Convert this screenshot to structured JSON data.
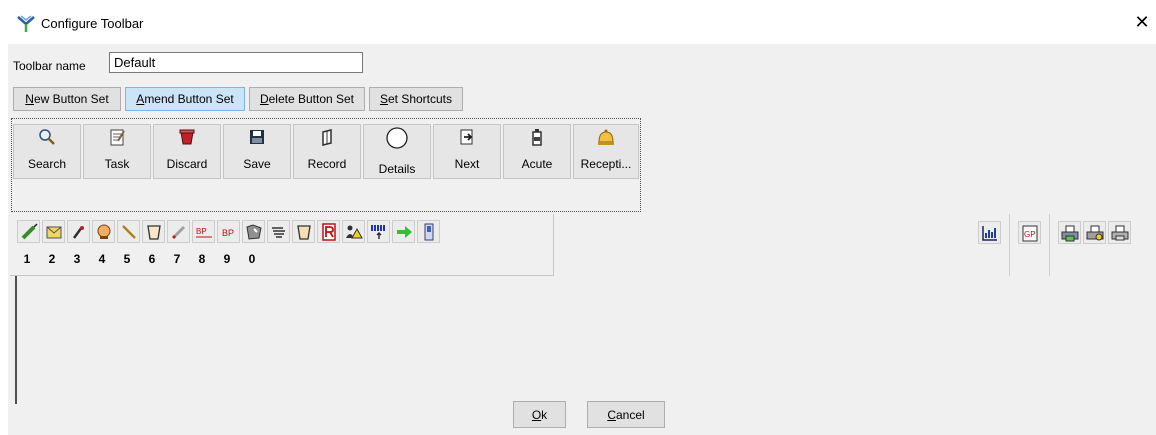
{
  "window": {
    "title": "Configure Toolbar",
    "app_icon": "dock-arrow-icon",
    "close_icon": "close-icon",
    "close_glyph": "✕"
  },
  "toolbar_name": {
    "label": "Toolbar name",
    "value": "Default"
  },
  "set_buttons": [
    {
      "label": "New Button Set",
      "active": false
    },
    {
      "label": "Amend Button Set",
      "active": true
    },
    {
      "label": "Delete Button Set",
      "active": false
    },
    {
      "label": "Set Shortcuts",
      "active": false
    }
  ],
  "toolbar_buttons": [
    {
      "label": "Search",
      "icon": "search-icon"
    },
    {
      "label": "Task",
      "icon": "task-icon"
    },
    {
      "label": "Discard",
      "icon": "discard-icon"
    },
    {
      "label": "Save",
      "icon": "save-icon"
    },
    {
      "label": "Record",
      "icon": "record-icon"
    },
    {
      "label": "Details",
      "icon": "details-circle-icon"
    },
    {
      "label": "Next",
      "icon": "next-icon"
    },
    {
      "label": "Acute",
      "icon": "acute-icon"
    },
    {
      "label": "Recepti...",
      "icon": "reception-bell-icon"
    }
  ],
  "shortcut_icons": [
    "syringe-icon",
    "envelope-icon",
    "pen-icon",
    "head-icon",
    "needle-icon",
    "cup-icon",
    "pencil-icon",
    "bp-chart-icon",
    "bp-icon",
    "map-icon",
    "hand-icon",
    "jar-icon",
    "r-document-icon",
    "warning-people-icon",
    "bar-upload-icon",
    "arrow-right-icon",
    "phone-icon"
  ],
  "shortcut_numbers": [
    "1",
    "2",
    "3",
    "4",
    "5",
    "6",
    "7",
    "8",
    "9",
    "0"
  ],
  "bp_text": "BP",
  "gp_text": "GP",
  "right_icons": [
    "graph-icon",
    "gp-clipboard-icon",
    "printer-icon",
    "printer-settings-icon",
    "printer-gray-icon"
  ],
  "dialog": {
    "ok": "Ok",
    "cancel": "Cancel"
  }
}
